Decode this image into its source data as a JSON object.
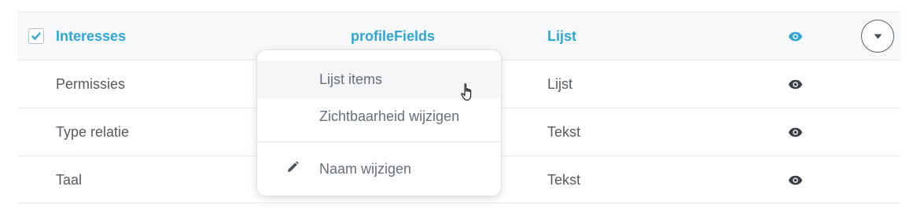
{
  "rows": [
    {
      "name": "Interesses",
      "key": "profileFields",
      "type": "Lijst",
      "checked": true,
      "selected": true
    },
    {
      "name": "Permissies",
      "key": "",
      "type": "Lijst",
      "checked": false,
      "selected": false
    },
    {
      "name": "Type relatie",
      "key": "",
      "type": "Tekst",
      "checked": false,
      "selected": false
    },
    {
      "name": "Taal",
      "key": "",
      "type": "Tekst",
      "checked": false,
      "selected": false
    }
  ],
  "dropdown": {
    "items": [
      {
        "label": "Lijst items",
        "icon": "",
        "hovered": true
      },
      {
        "label": "Zichtbaarheid wijzigen",
        "icon": "",
        "hovered": false
      },
      {
        "label": "Naam wijzigen",
        "icon": "pencil-icon",
        "hovered": false
      }
    ]
  },
  "colors": {
    "accent": "#2fa6d6",
    "text": "#555a60",
    "muted": "#66707a",
    "border": "#e8eaed"
  },
  "icons": {
    "visibility": "eye-icon",
    "menu_toggle": "caret-down-icon",
    "checkbox": "checkmark-icon",
    "cursor": "hand-pointer-icon"
  }
}
